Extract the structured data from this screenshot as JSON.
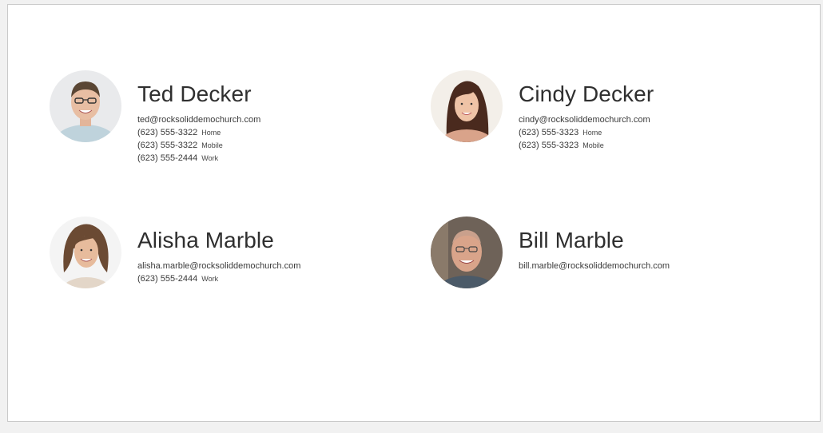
{
  "people": [
    {
      "name": "Ted Decker",
      "email": "ted@rocksoliddemochurch.com",
      "phones": [
        {
          "number": "(623) 555-3322",
          "type": "Home"
        },
        {
          "number": "(623) 555-3322",
          "type": "Mobile"
        },
        {
          "number": "(623) 555-2444",
          "type": "Work"
        }
      ]
    },
    {
      "name": "Cindy Decker",
      "email": "cindy@rocksoliddemochurch.com",
      "phones": [
        {
          "number": "(623) 555-3323",
          "type": "Home"
        },
        {
          "number": "(623) 555-3323",
          "type": "Mobile"
        }
      ]
    },
    {
      "name": "Alisha Marble",
      "email": "alisha.marble@rocksoliddemochurch.com",
      "phones": [
        {
          "number": "(623) 555-2444",
          "type": "Work"
        }
      ]
    },
    {
      "name": "Bill Marble",
      "email": "bill.marble@rocksoliddemochurch.com",
      "phones": []
    }
  ]
}
